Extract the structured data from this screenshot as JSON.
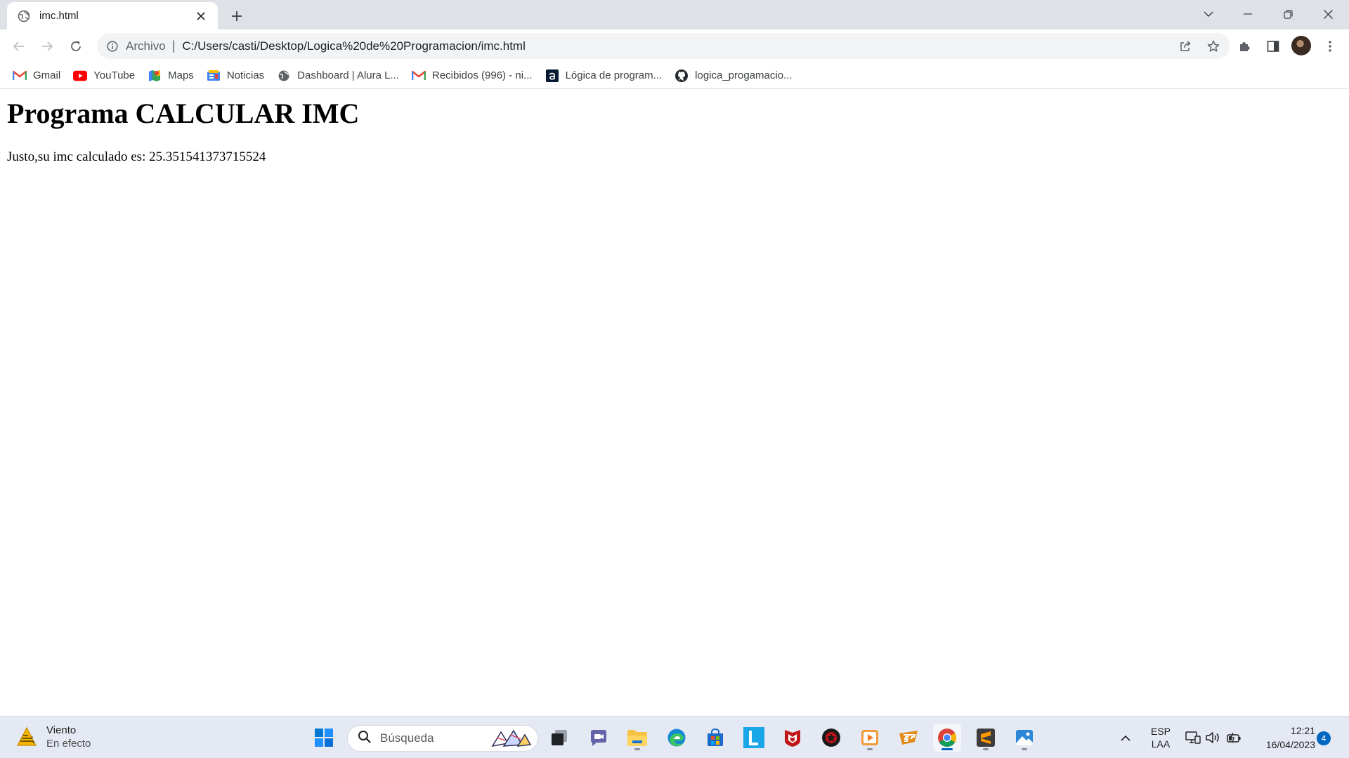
{
  "browser": {
    "tab": {
      "title": "imc.html"
    },
    "address_bar": {
      "scheme_label": "Archivo",
      "separator": "|",
      "url": "C:/Users/casti/Desktop/Logica%20de%20Programacion/imc.html"
    },
    "bookmarks": [
      {
        "label": "Gmail",
        "icon": "gmail-icon"
      },
      {
        "label": "YouTube",
        "icon": "youtube-icon"
      },
      {
        "label": "Maps",
        "icon": "maps-icon"
      },
      {
        "label": "Noticias",
        "icon": "news-icon"
      },
      {
        "label": "Dashboard | Alura L...",
        "icon": "globe-icon"
      },
      {
        "label": "Recibidos (996) - ni...",
        "icon": "gmail-icon"
      },
      {
        "label": "Lógica de program...",
        "icon": "alura-icon"
      },
      {
        "label": "logica_progamacio...",
        "icon": "github-icon"
      }
    ]
  },
  "page": {
    "heading": "Programa CALCULAR IMC",
    "result_text": "Justo,su imc calculado es: 25.351541373715524"
  },
  "taskbar": {
    "weather": {
      "title": "Viento",
      "subtitle": "En efecto"
    },
    "search": {
      "placeholder": "Búsqueda"
    },
    "language": {
      "line1": "ESP",
      "line2": "LAA"
    },
    "clock": {
      "time": "12:21",
      "date": "16/04/2023"
    },
    "notification_count": "4",
    "apps": [
      "start",
      "search",
      "task-view",
      "teams-chat",
      "file-explorer",
      "edge",
      "microsoft-store",
      "l-app",
      "mcafee",
      "game-app",
      "media-player",
      "free-fire",
      "chrome",
      "sublime-text",
      "photos"
    ]
  },
  "colors": {
    "tabstrip_bg": "#dee1e6",
    "omnibox_bg": "#f1f3f4",
    "taskbar_bg": "#e4e9f3",
    "accent_blue": "#0067c0",
    "youtube_red": "#ff0000"
  }
}
